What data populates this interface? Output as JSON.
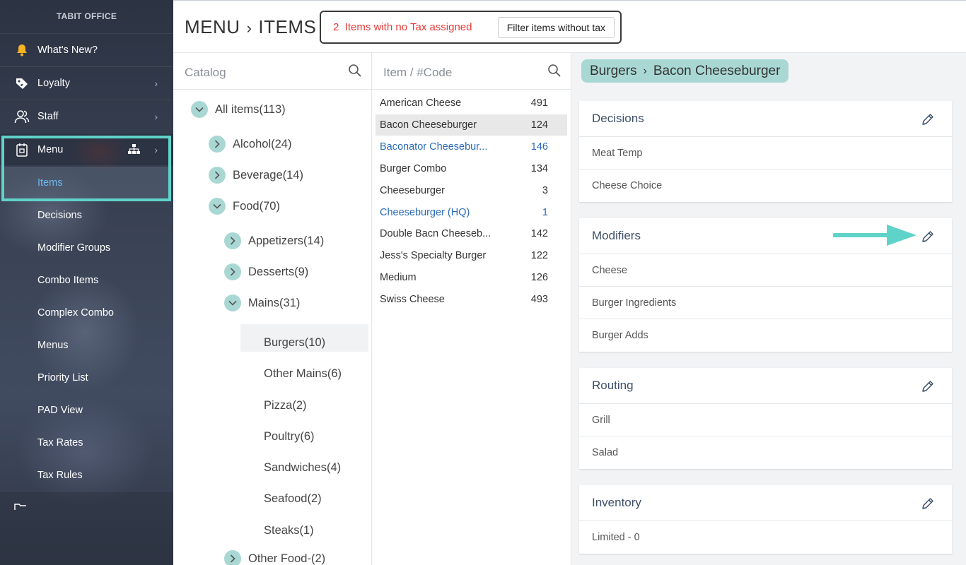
{
  "sidebar": {
    "brand": "TABIT OFFICE",
    "top_items": [
      {
        "label": "What's New?",
        "icon": "bell-icon"
      },
      {
        "label": "Loyalty",
        "icon": "tag-icon"
      },
      {
        "label": "Staff",
        "icon": "users-icon"
      },
      {
        "label": "Menu",
        "icon": "menu-book-icon"
      }
    ],
    "menu_sub_items": [
      "Items",
      "Decisions",
      "Modifier Groups",
      "Combo Items",
      "Complex Combo",
      "Menus",
      "Priority List",
      "PAD View",
      "Tax Rates",
      "Tax Rules"
    ]
  },
  "header": {
    "breadcrumb": [
      "MENU",
      "ITEMS"
    ],
    "tax_alert": {
      "message": "2  Items with no Tax assigned",
      "button": "Filter items without tax"
    }
  },
  "catalog": {
    "search_placeholder": "Catalog",
    "tree": [
      {
        "label": "All items(113)",
        "state": "expanded"
      },
      {
        "label": "Alcohol(24)",
        "state": "collapsed"
      },
      {
        "label": "Beverage(14)",
        "state": "collapsed"
      },
      {
        "label": "Food(70)",
        "state": "expanded"
      },
      {
        "label": "Appetizers(14)",
        "state": "collapsed"
      },
      {
        "label": "Desserts(9)",
        "state": "collapsed"
      },
      {
        "label": "Mains(31)",
        "state": "expanded"
      },
      {
        "label": "Burgers(10)",
        "state": "selected"
      },
      {
        "label": "Other Mains(6)",
        "state": "leaf"
      },
      {
        "label": "Pizza(2)",
        "state": "leaf"
      },
      {
        "label": "Poultry(6)",
        "state": "leaf"
      },
      {
        "label": "Sandwiches(4)",
        "state": "leaf"
      },
      {
        "label": "Seafood(2)",
        "state": "leaf"
      },
      {
        "label": "Steaks(1)",
        "state": "leaf"
      },
      {
        "label": "Other Food-(2)",
        "state": "collapsed"
      }
    ]
  },
  "items": {
    "search_placeholder": "Item / #Code",
    "rows": [
      {
        "name": "American Cheese",
        "code": "491"
      },
      {
        "name": "Bacon Cheeseburger",
        "code": "124"
      },
      {
        "name": "Baconator Cheesebur...",
        "code": "146"
      },
      {
        "name": "Burger Combo",
        "code": "134"
      },
      {
        "name": "Cheeseburger",
        "code": "3"
      },
      {
        "name": "Cheeseburger (HQ)",
        "code": "1"
      },
      {
        "name": "Double Bacn Cheeseb...",
        "code": "142"
      },
      {
        "name": "Jess's Specialty Burger",
        "code": "122"
      },
      {
        "name": "Medium",
        "code": "126"
      },
      {
        "name": "Swiss Cheese",
        "code": "493"
      }
    ],
    "selected_index": 1,
    "hq_indices": [
      2,
      5
    ],
    "hq_color": "#2a6bb5"
  },
  "detail": {
    "breadcrumb": [
      "Burgers",
      "Bacon Cheeseburger"
    ],
    "cards": [
      {
        "title": "Decisions",
        "rows": [
          "Meat Temp",
          "Cheese Choice"
        ]
      },
      {
        "title": "Modifiers",
        "rows": [
          "Cheese",
          "Burger Ingredients",
          "Burger Adds"
        ]
      },
      {
        "title": "Routing",
        "rows": [
          "Grill",
          "Salad"
        ]
      },
      {
        "title": "Inventory",
        "rows": [
          "Limited - 0"
        ]
      }
    ]
  },
  "colors": {
    "accent": "#5fd3c9",
    "chip": "#a9d8d4",
    "alert_text": "#e53935",
    "active_link": "#6ab8f0"
  }
}
